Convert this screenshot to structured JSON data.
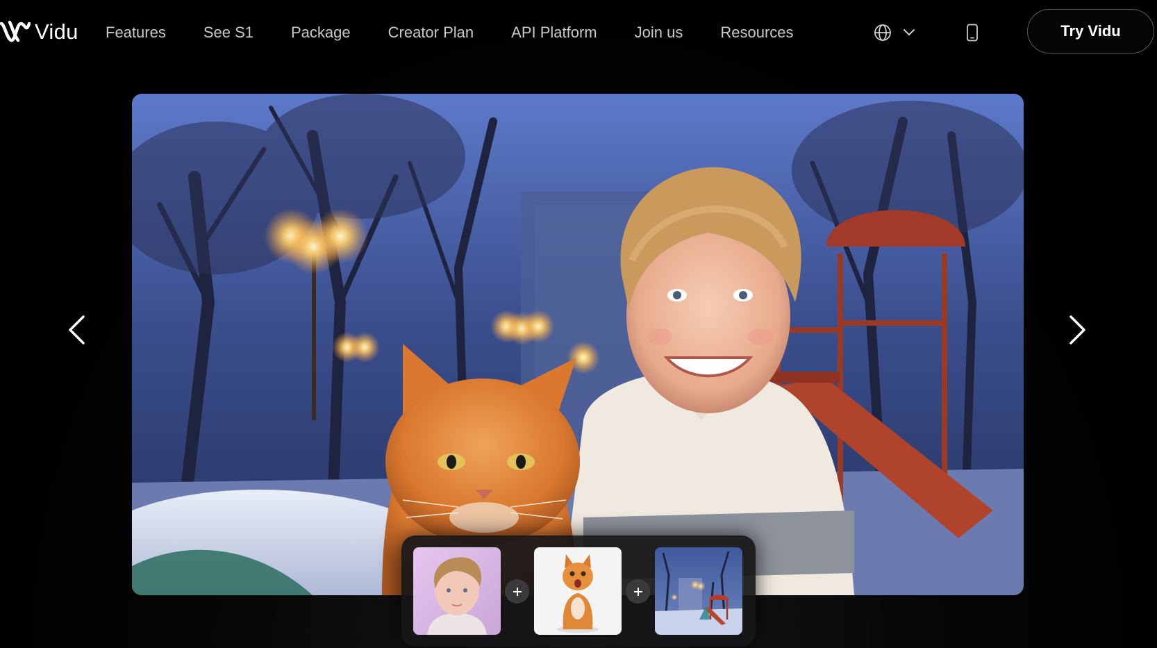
{
  "brand": {
    "name": "Vidu",
    "logo_icon": "vidu-logo-icon"
  },
  "nav": {
    "items": [
      {
        "label": "Features"
      },
      {
        "label": "See S1"
      },
      {
        "label": "Package"
      },
      {
        "label": "Creator Plan"
      },
      {
        "label": "API Platform"
      },
      {
        "label": "Join us"
      },
      {
        "label": "Resources"
      }
    ]
  },
  "header": {
    "language_icon": "globe-icon",
    "language_dropdown_icon": "chevron-down-icon",
    "mobile_icon": "smartphone-icon",
    "cta_label": "Try Vidu"
  },
  "hero": {
    "prev_icon": "chevron-left-icon",
    "next_icon": "chevron-right-icon"
  },
  "reference_tray": {
    "separator_icon": "plus-icon",
    "thumbnails": [
      {
        "subject": "boy-portrait"
      },
      {
        "subject": "orange-cat"
      },
      {
        "subject": "snowy-playground"
      }
    ]
  },
  "colors": {
    "background": "#000000",
    "nav_text": "#c9c9c9",
    "cta_border": "#5a5a5a",
    "tray_bg": "#161618",
    "plus_bg": "#3a3a3d"
  }
}
